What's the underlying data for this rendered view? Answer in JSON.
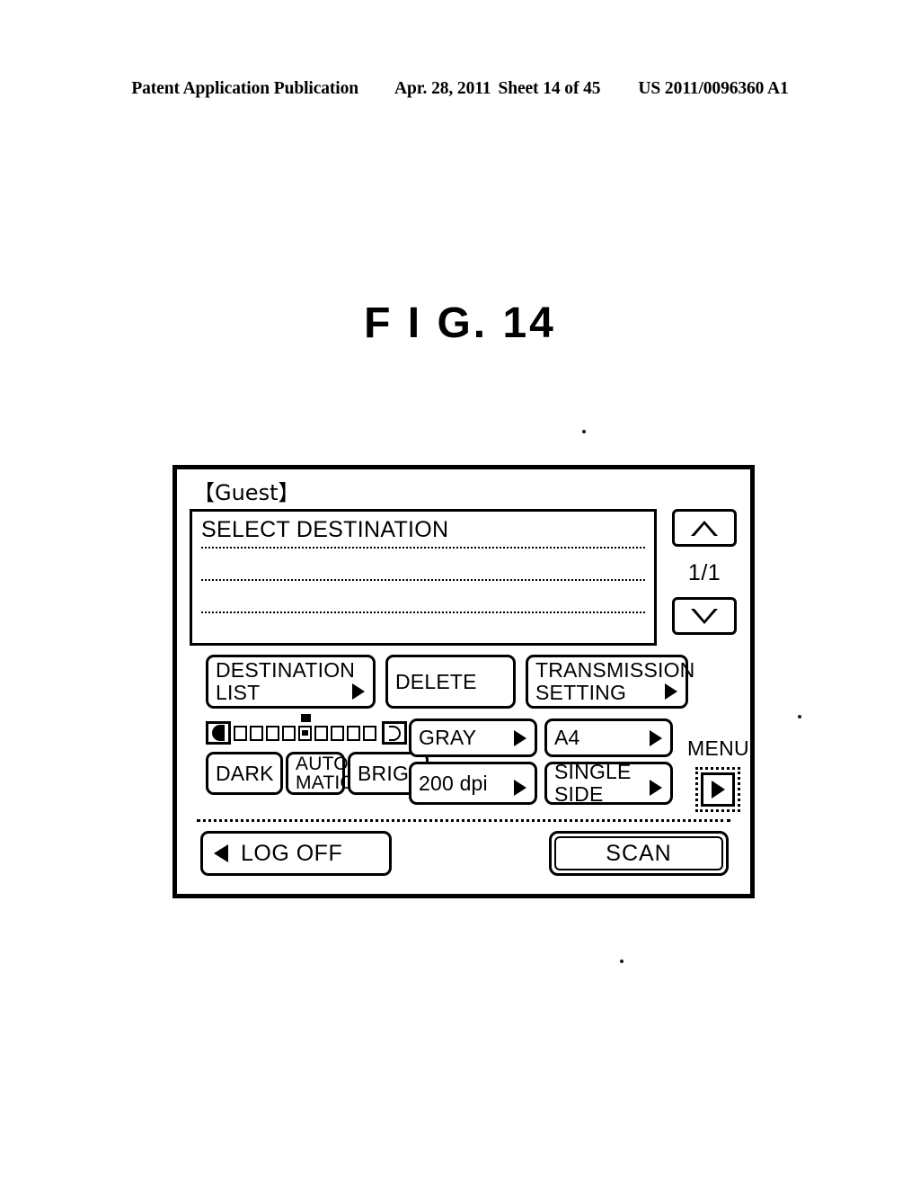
{
  "patent_header": {
    "publication": "Patent Application Publication",
    "date": "Apr. 28, 2011",
    "sheet": "Sheet 14 of 45",
    "number": "US 2011/0096360 A1"
  },
  "figure": {
    "title": "F I G. 14"
  },
  "device_panel": {
    "user_label": "【Guest】",
    "destination_list": {
      "title": "SELECT DESTINATION",
      "empty_rows": [
        "",
        "",
        ""
      ]
    },
    "scroll": {
      "up_icon": "triangle-up-icon",
      "down_icon": "triangle-down-icon",
      "page_indicator": "1/1"
    },
    "action_buttons": [
      {
        "label_line1": "DESTINATION",
        "label_line2": "LIST",
        "has_arrow": true
      },
      {
        "label_line1": "DELETE",
        "label_line2": "",
        "has_arrow": false
      },
      {
        "label_line1": "TRANSMISSION",
        "label_line2": "SETTING",
        "has_arrow": true
      }
    ],
    "density": {
      "dark_end_icon": "half-circle-dark-icon",
      "bright_end_icon": "half-circle-light-icon",
      "steps": 9,
      "selected_step": 5
    },
    "tone_buttons": [
      {
        "label_line1": "DARK",
        "label_line2": ""
      },
      {
        "label_line1": "AUTO-",
        "label_line2": "MATIC"
      },
      {
        "label_line1": "BRIGHT",
        "label_line2": ""
      }
    ],
    "dropdowns": [
      {
        "label_line1": "GRAY",
        "label_line2": "",
        "has_arrow": true
      },
      {
        "label_line1": "A4",
        "label_line2": "",
        "has_arrow": true
      },
      {
        "label_line1": "200 dpi",
        "label_line2": "",
        "has_arrow": true
      },
      {
        "label_line1": "SINGLE",
        "label_line2": "SIDE",
        "has_arrow": true
      }
    ],
    "menu": {
      "label": "MENU",
      "button_icon": "triangle-right-icon"
    },
    "bottom": {
      "logoff_label": "LOG OFF",
      "logoff_icon": "triangle-left-icon",
      "scan_label": "SCAN"
    }
  },
  "colors": {
    "ink": "#000000",
    "paper": "#ffffff"
  }
}
